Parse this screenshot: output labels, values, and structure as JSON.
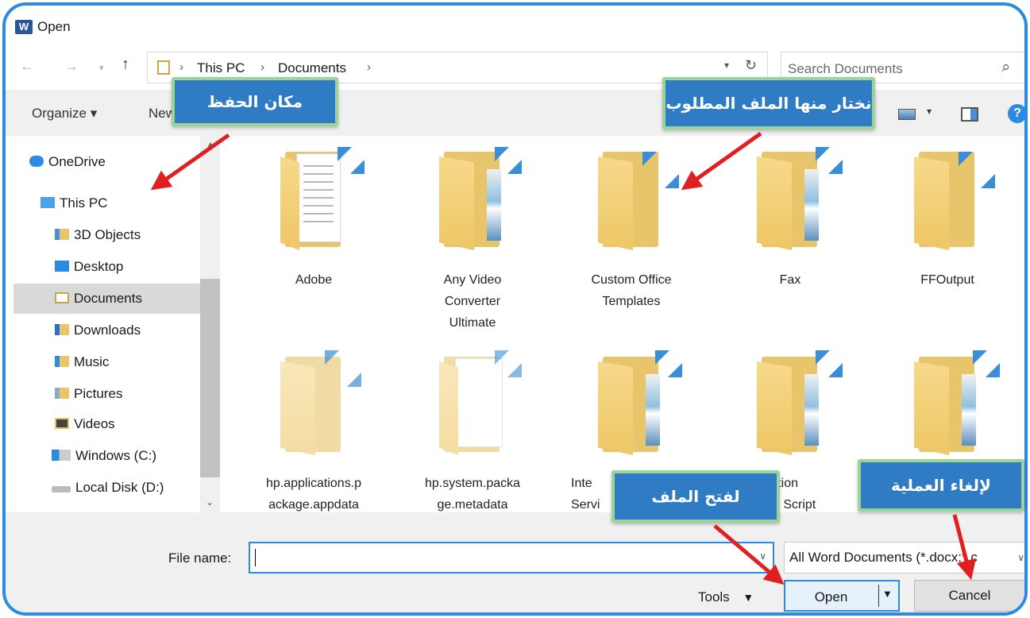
{
  "window": {
    "title": "Open",
    "app_logo": "W"
  },
  "address_bar": {
    "breadcrumbs": [
      "This PC",
      "Documents"
    ],
    "search_placeholder": "Search Documents"
  },
  "toolbar": {
    "organize_label": "Organize ▾",
    "new_folder_label": "New folder"
  },
  "nav": {
    "items": [
      {
        "label": "OneDrive",
        "icon": "cloud-icon"
      },
      {
        "label": "This PC",
        "icon": "computer-icon"
      },
      {
        "label": "3D Objects",
        "icon": "3d-objects-icon"
      },
      {
        "label": "Desktop",
        "icon": "desktop-icon"
      },
      {
        "label": "Documents",
        "icon": "documents-icon",
        "selected": true
      },
      {
        "label": "Downloads",
        "icon": "downloads-icon"
      },
      {
        "label": "Music",
        "icon": "music-icon"
      },
      {
        "label": "Pictures",
        "icon": "pictures-icon"
      },
      {
        "label": "Videos",
        "icon": "videos-icon"
      },
      {
        "label": "Windows (C:)",
        "icon": "windows-drive-icon"
      },
      {
        "label": "Local Disk (D:)",
        "icon": "local-disk-icon"
      }
    ]
  },
  "files": [
    {
      "name": "Adobe",
      "label_lines": [
        "Adobe"
      ]
    },
    {
      "name": "Any Video Converter Ultimate",
      "label_lines": [
        "Any Video",
        "Converter",
        "Ultimate"
      ]
    },
    {
      "name": "Custom Office Templates",
      "label_lines": [
        "Custom Office",
        "Templates"
      ]
    },
    {
      "name": "Fax",
      "label_lines": [
        "Fax"
      ]
    },
    {
      "name": "FFOutput",
      "label_lines": [
        "FFOutput"
      ]
    },
    {
      "name": "hp.applications.package.appdata",
      "label_lines": [
        "hp.applications.p",
        "ackage.appdata"
      ]
    },
    {
      "name": "hp.system.package.metadata",
      "label_lines": [
        "hp.system.packa",
        "ge.metadata"
      ]
    },
    {
      "name": "Integration Services",
      "label_lines": [
        "Inte",
        "Servi"
      ]
    },
    {
      "name": "Migration Scripts",
      "label_lines": [
        "ration",
        "es Script"
      ]
    },
    {
      "name": "",
      "label_lines": []
    }
  ],
  "bottom": {
    "file_name_label": "File name:",
    "file_name_value": "",
    "file_type_filter": "All Word Documents (*.docx;*.c",
    "tools_label": "Tools",
    "open_label": "Open",
    "cancel_label": "Cancel"
  },
  "annotations": {
    "save_location": "مكان الحفظ",
    "choose_file": "نختار منها الملف المطلوب",
    "open_file": "لفتح الملف",
    "cancel_operation": "لإلغاء العملية"
  },
  "colors": {
    "accent": "#2c8be0",
    "callout_bg": "#2f7cc4",
    "callout_border": "#9bd39b",
    "arrow": "#e02020",
    "folder": "#e8c46a"
  }
}
